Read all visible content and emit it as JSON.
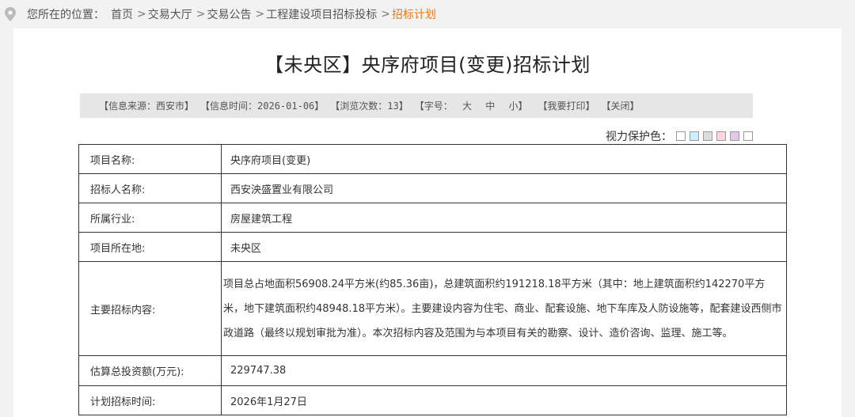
{
  "breadcrumb": {
    "label": "您所在的位置：",
    "items": [
      {
        "text": "首页"
      },
      {
        "text": "交易大厅"
      },
      {
        "text": "交易公告"
      },
      {
        "text": "工程建设项目招标投标"
      },
      {
        "text": "招标计划"
      }
    ],
    "separator": ">"
  },
  "title": "【未央区】央序府项目(变更)招标计划",
  "meta": {
    "source": "【信息来源：西安市】",
    "time": "【信息时间：2026-01-06】",
    "views": "【浏览次数：13】",
    "font_label": "【字号：",
    "size_large": "大",
    "size_medium": "中",
    "size_small": "小】",
    "print": "【我要打印】",
    "close": "【关闭】"
  },
  "eye_protection": {
    "label": "视力保护色：",
    "swatches": [
      "#ffffff",
      "#cceeff",
      "#dddddd",
      "#ffd6e0",
      "#e0c8f0",
      "#ffffff"
    ]
  },
  "rows": [
    {
      "label": "项目名称:",
      "value": "央序府项目(变更)"
    },
    {
      "label": "招标人名称:",
      "value": "西安泱盛置业有限公司"
    },
    {
      "label": "所属行业:",
      "value": "房屋建筑工程"
    },
    {
      "label": "项目所在地:",
      "value": "未央区"
    },
    {
      "label": "主要招标内容:",
      "value": "项目总占地面积56908.24平方米(约85.36亩)，总建筑面积约191218.18平方米（其中：地上建筑面积约142270平方米，地下建筑面积约48948.18平方米）。主要建设内容为住宅、商业、配套设施、地下车库及人防设施等，配套建设西侧市政道路（最终以规划审批为准）。本次招标内容及范围为与本项目有关的勘察、设计、造价咨询、监理、施工等。"
    },
    {
      "label": "估算总投资额(万元):",
      "value": "229747.38"
    },
    {
      "label": "计划招标时间:",
      "value": "2026年1月27日"
    }
  ],
  "colors": {
    "accent": "#e8791c",
    "meta_bg": "#e6e6e6"
  }
}
